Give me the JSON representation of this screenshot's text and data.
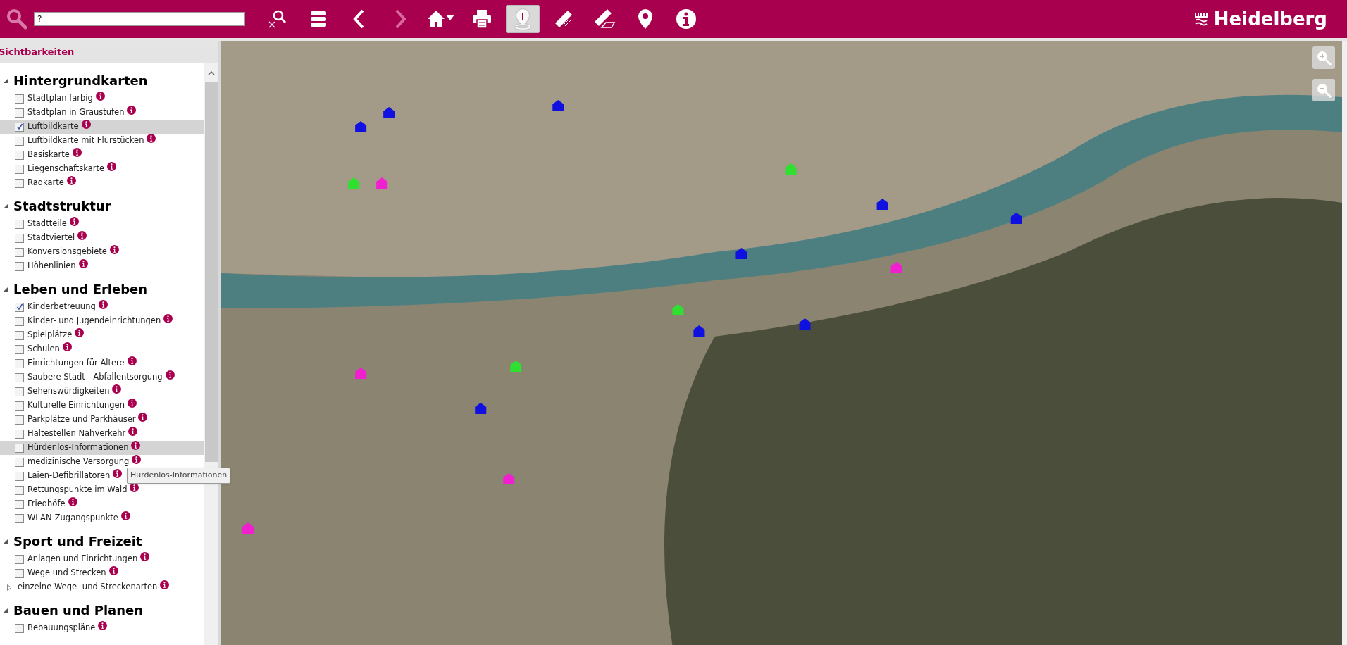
{
  "toolbar": {
    "search": {
      "value": "?"
    },
    "buttons": [
      {
        "kind": "search-clear",
        "selected": false
      },
      {
        "kind": "layers",
        "selected": false
      },
      {
        "kind": "back",
        "selected": false,
        "disabled": false
      },
      {
        "kind": "forward",
        "selected": false,
        "disabled": true
      },
      {
        "kind": "home",
        "selected": false
      },
      {
        "kind": "print",
        "selected": false
      },
      {
        "kind": "info-pin",
        "selected": true
      },
      {
        "kind": "ruler",
        "selected": false
      },
      {
        "kind": "area-ruler",
        "selected": false
      },
      {
        "kind": "pin",
        "selected": false
      },
      {
        "kind": "info",
        "selected": false
      }
    ],
    "brand": "Heidelberg"
  },
  "sidebar": {
    "title": "Sichtbarkeiten",
    "sections": [
      {
        "title": "Hintergrundkarten",
        "expanded": true,
        "items": [
          {
            "kind": "checkbox",
            "label": "Stadtplan farbig",
            "checked": false,
            "highlighted": false
          },
          {
            "kind": "checkbox",
            "label": "Stadtplan in Graustufen",
            "checked": false,
            "highlighted": false
          },
          {
            "kind": "checkbox",
            "label": "Luftbildkarte",
            "checked": true,
            "highlighted": true
          },
          {
            "kind": "checkbox",
            "label": "Luftbildkarte mit Flurstücken",
            "checked": false,
            "highlighted": false
          },
          {
            "kind": "checkbox",
            "label": "Basiskarte",
            "checked": false,
            "highlighted": false
          },
          {
            "kind": "checkbox",
            "label": "Liegenschaftskarte",
            "checked": false,
            "highlighted": false
          },
          {
            "kind": "checkbox",
            "label": "Radkarte",
            "checked": false,
            "highlighted": false
          }
        ]
      },
      {
        "title": "Stadtstruktur",
        "expanded": true,
        "items": [
          {
            "kind": "checkbox",
            "label": "Stadtteile",
            "checked": false,
            "highlighted": false
          },
          {
            "kind": "checkbox",
            "label": "Stadtviertel",
            "checked": false,
            "highlighted": false
          },
          {
            "kind": "checkbox",
            "label": "Konversionsgebiete",
            "checked": false,
            "highlighted": false
          },
          {
            "kind": "checkbox",
            "label": "Höhenlinien",
            "checked": false,
            "highlighted": false
          }
        ]
      },
      {
        "title": "Leben und Erleben",
        "expanded": true,
        "items": [
          {
            "kind": "checkbox",
            "label": "Kinderbetreuung",
            "checked": true,
            "highlighted": false
          },
          {
            "kind": "checkbox",
            "label": "Kinder- und Jugendeinrichtungen",
            "checked": false,
            "highlighted": false
          },
          {
            "kind": "checkbox",
            "label": "Spielplätze",
            "checked": false,
            "highlighted": false
          },
          {
            "kind": "checkbox",
            "label": "Schulen",
            "checked": false,
            "highlighted": false
          },
          {
            "kind": "checkbox",
            "label": "Einrichtungen für Ältere",
            "checked": false,
            "highlighted": false
          },
          {
            "kind": "checkbox",
            "label": "Saubere Stadt - Abfallentsorgung",
            "checked": false,
            "highlighted": false
          },
          {
            "kind": "checkbox",
            "label": "Sehenswürdigkeiten",
            "checked": false,
            "highlighted": false
          },
          {
            "kind": "checkbox",
            "label": "Kulturelle Einrichtungen",
            "checked": false,
            "highlighted": false
          },
          {
            "kind": "checkbox",
            "label": "Parkplätze und Parkhäuser",
            "checked": false,
            "highlighted": false
          },
          {
            "kind": "checkbox",
            "label": "Haltestellen Nahverkehr",
            "checked": false,
            "highlighted": false
          },
          {
            "kind": "checkbox",
            "label": "Hürdenlos-Informationen",
            "checked": false,
            "highlighted": true
          },
          {
            "kind": "checkbox",
            "label": "medizinische Versorgung",
            "checked": false,
            "highlighted": false
          },
          {
            "kind": "checkbox",
            "label": "Laien-Defibrillatoren",
            "checked": false,
            "highlighted": false
          },
          {
            "kind": "checkbox",
            "label": "Rettungspunkte im Wald",
            "checked": false,
            "highlighted": false
          },
          {
            "kind": "checkbox",
            "label": "Friedhöfe",
            "checked": false,
            "highlighted": false
          },
          {
            "kind": "checkbox",
            "label": "WLAN-Zugangspunkte",
            "checked": false,
            "highlighted": false
          }
        ]
      },
      {
        "title": "Sport und Freizeit",
        "expanded": true,
        "items": [
          {
            "kind": "checkbox",
            "label": "Anlagen und Einrichtungen",
            "checked": false,
            "highlighted": false
          },
          {
            "kind": "checkbox",
            "label": "Wege und Strecken",
            "checked": false,
            "highlighted": false
          },
          {
            "kind": "group",
            "label": "einzelne Wege- und Streckenarten",
            "expanded": false,
            "highlighted": false
          }
        ]
      },
      {
        "title": "Bauen und Planen",
        "expanded": true,
        "items": [
          {
            "kind": "checkbox",
            "label": "Bebauungspläne",
            "checked": false,
            "highlighted": false
          }
        ]
      }
    ],
    "tooltip": "Hürdenlos-Informationen"
  }
}
